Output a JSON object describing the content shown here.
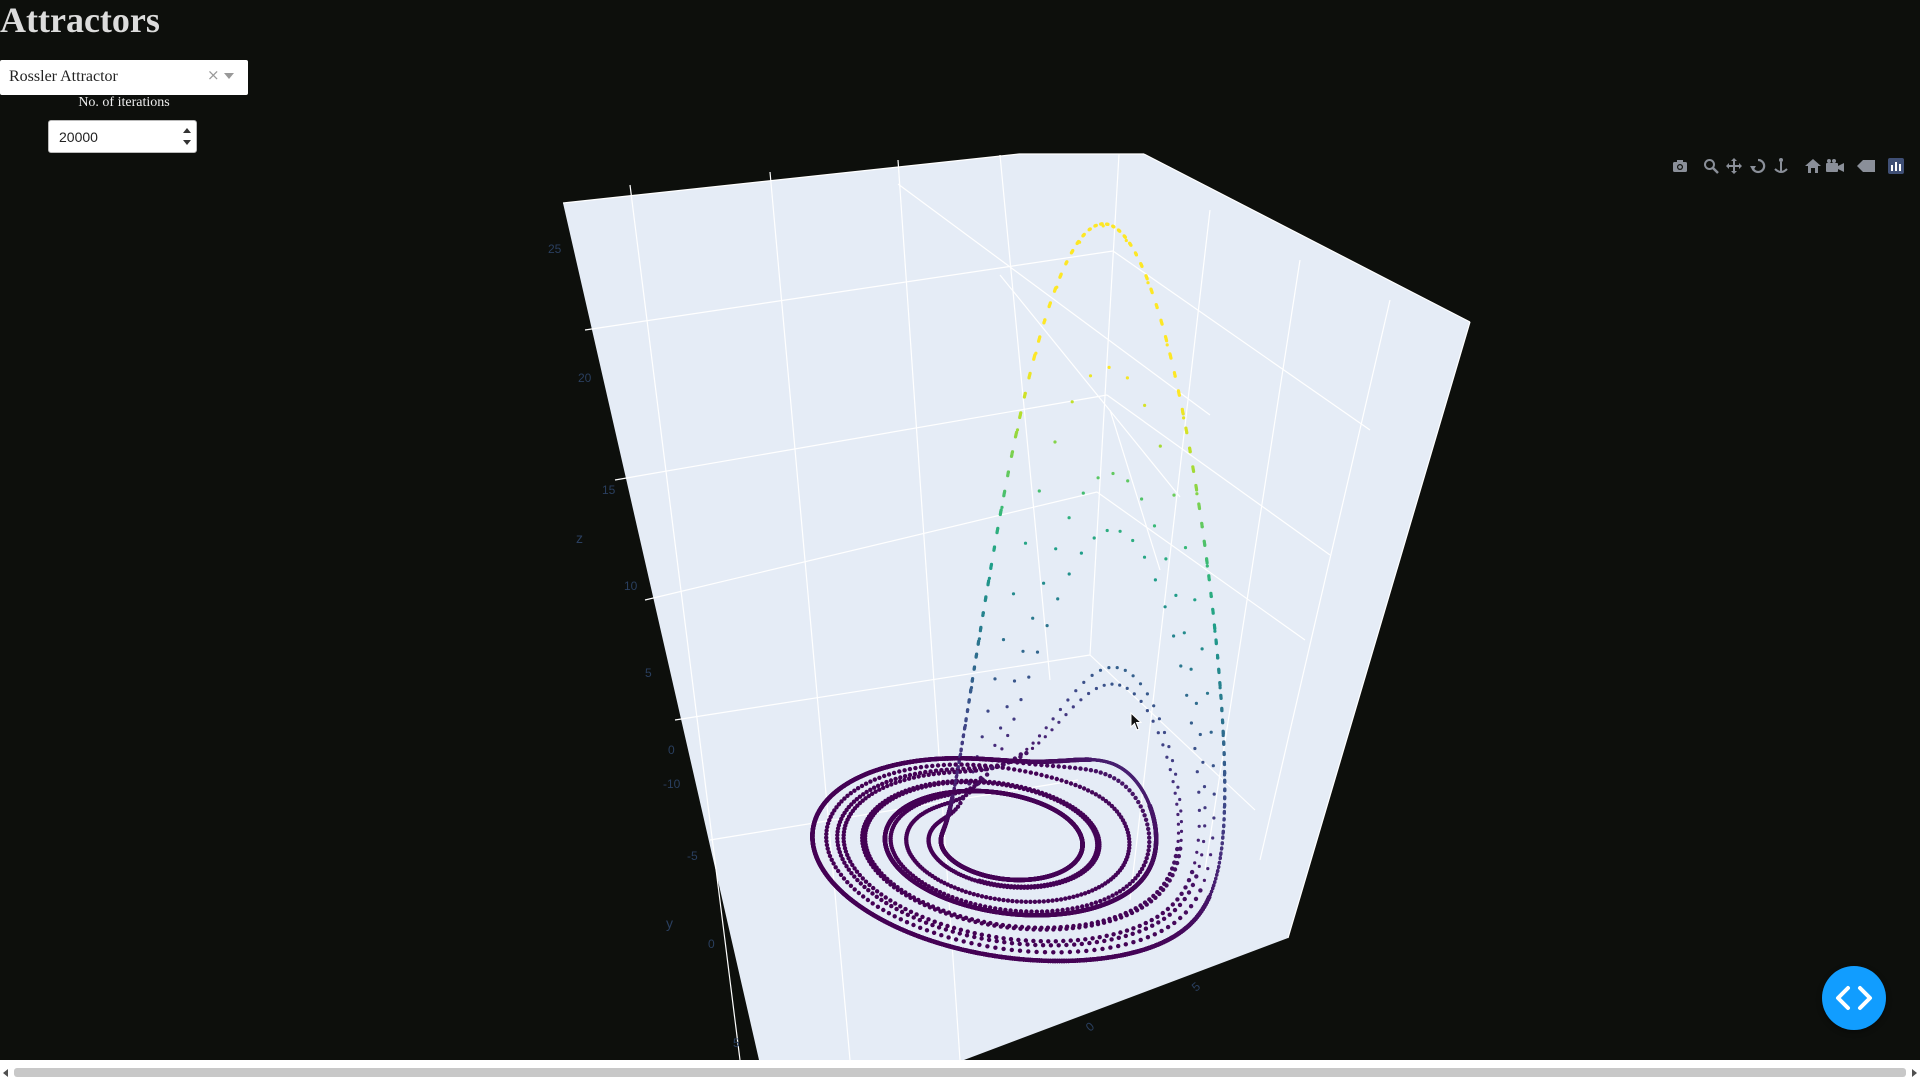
{
  "page": {
    "title": "Attractors"
  },
  "controls": {
    "attractor_select": {
      "value": "Rossler Attractor",
      "clear": "×"
    },
    "iterations": {
      "label": "No. of iterations",
      "value": "20000"
    }
  },
  "modebar": {
    "icons": [
      "camera-icon",
      "zoom-icon",
      "pan-icon",
      "orbit-rotation-icon",
      "turntable-rotation-icon",
      "reset-camera-icon",
      "camera-last-save-icon",
      "hover-toggle-icon",
      "plotly-logo-icon"
    ]
  },
  "colors": {
    "background": "#0d0f0c",
    "scene_bg": "#e5ecf6",
    "accent": "#119dff"
  },
  "chart_data": {
    "type": "scatter3d",
    "title": "",
    "colorscale": "Viridis",
    "marker_color_by": "z",
    "axes": {
      "x": {
        "title": "",
        "tick_labels": [
          "0",
          "5"
        ]
      },
      "y": {
        "title": "y",
        "tick_labels": [
          "-10",
          "-5",
          "0",
          "5"
        ]
      },
      "z": {
        "title": "z",
        "tick_labels": [
          "0",
          "5",
          "10",
          "15",
          "20",
          "25"
        ]
      }
    },
    "system": {
      "name": "Rossler Attractor",
      "iterations": 20000
    }
  }
}
